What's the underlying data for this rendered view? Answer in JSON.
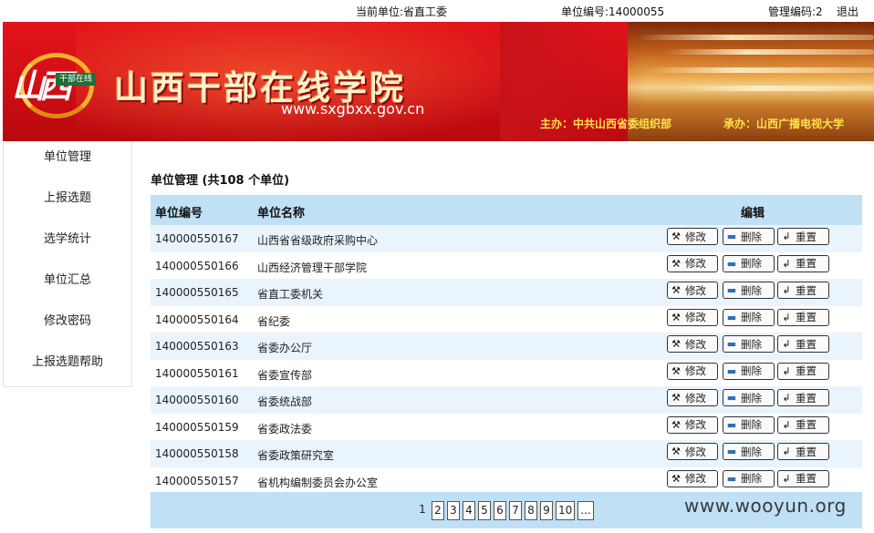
{
  "topbar": {
    "current_unit": "当前单位:省直工委",
    "unit_code": "单位编号:14000055",
    "manage_code": "管理编码:2",
    "logout": "退出"
  },
  "banner": {
    "logo_brush": "山西",
    "logo_tag": "干部在线",
    "title": "山西干部在线学院",
    "url": "www.sxgbxx.gov.cn",
    "sponsor": "主办：中共山西省委组织部",
    "organizer": "承办：山西广播电视大学"
  },
  "sidebar": {
    "items": [
      {
        "label": "单位管理"
      },
      {
        "label": "上报选题"
      },
      {
        "label": "选学统计"
      },
      {
        "label": "单位汇总"
      },
      {
        "label": "修改密码"
      },
      {
        "label": "上报选题帮助"
      }
    ]
  },
  "main": {
    "title": "单位管理 (共108 个单位)",
    "columns": {
      "id": "单位编号",
      "name": "单位名称",
      "edit": "编辑"
    },
    "buttons": {
      "edit": "修改",
      "delete": "删除",
      "reset": "重置"
    },
    "rows": [
      {
        "id": "140000550167",
        "name": "山西省省级政府采购中心"
      },
      {
        "id": "140000550166",
        "name": "山西经济管理干部学院"
      },
      {
        "id": "140000550165",
        "name": "省直工委机关"
      },
      {
        "id": "140000550164",
        "name": "省纪委"
      },
      {
        "id": "140000550163",
        "name": "省委办公厅"
      },
      {
        "id": "140000550161",
        "name": "省委宣传部"
      },
      {
        "id": "140000550160",
        "name": "省委统战部"
      },
      {
        "id": "140000550159",
        "name": "省委政法委"
      },
      {
        "id": "140000550158",
        "name": "省委政策研究室"
      },
      {
        "id": "140000550157",
        "name": "省机构编制委员会办公室"
      }
    ]
  },
  "pager": {
    "current": "1",
    "pages": [
      "2",
      "3",
      "4",
      "5",
      "6",
      "7",
      "8",
      "9",
      "10",
      "..."
    ]
  },
  "watermark": "www.wooyun.org",
  "icons": {
    "edit": "tools-icon",
    "delete": "minus-icon",
    "reset": "reset-icon"
  },
  "colors": {
    "banner_red": "#d40f16",
    "table_header": "#bfe0f5",
    "row_stripe": "#eaf4fc"
  }
}
